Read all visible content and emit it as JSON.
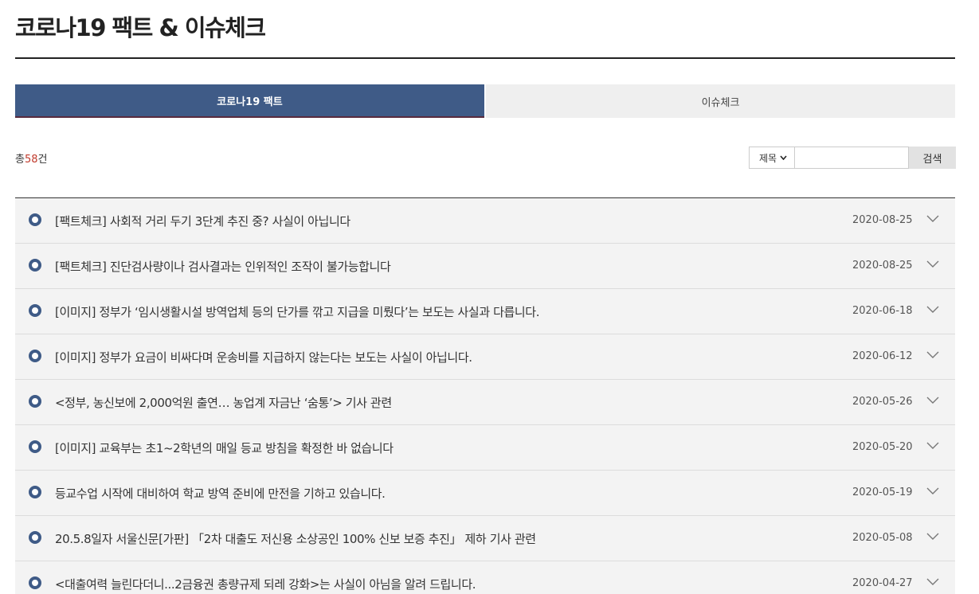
{
  "page": {
    "title": "코로나19 팩트 & 이슈체크"
  },
  "tabs": [
    {
      "label": "코로나19 팩트",
      "active": true
    },
    {
      "label": "이슈체크",
      "active": false
    }
  ],
  "summary": {
    "prefix": "총",
    "count": "58",
    "suffix": "건"
  },
  "search": {
    "select_value": "제목",
    "input_value": "",
    "button_label": "검색"
  },
  "list": [
    {
      "title": "[팩트체크] 사회적 거리 두기 3단계 추진 중? 사실이 아닙니다",
      "date": "2020-08-25"
    },
    {
      "title": "[팩트체크] 진단검사량이나 검사결과는 인위적인 조작이 불가능합니다",
      "date": "2020-08-25"
    },
    {
      "title": "[이미지] 정부가 ‘임시생활시설 방역업체 등의 단가를 깎고 지급을 미뤘다’는 보도는 사실과 다릅니다.",
      "date": "2020-06-18"
    },
    {
      "title": "[이미지] 정부가 요금이 비싸다며 운송비를 지급하지 않는다는 보도는 사실이 아닙니다.",
      "date": "2020-06-12"
    },
    {
      "title": "<정부, 농신보에 2,000억원 출연… 농업계 자금난 ‘숨통’> 기사 관련",
      "date": "2020-05-26"
    },
    {
      "title": "[이미지] 교육부는 초1~2학년의 매일 등교 방침을 확정한 바 없습니다",
      "date": "2020-05-20"
    },
    {
      "title": "등교수업 시작에 대비하여 학교 방역 준비에 만전을 기하고 있습니다.",
      "date": "2020-05-19"
    },
    {
      "title": "20.5.8일자 서울신문[가판] 「2차 대출도 저신용 소상공인 100% 신보 보증 추진」 제하 기사 관련",
      "date": "2020-05-08"
    },
    {
      "title": "<대출여력 늘린다더니...2금융권 총량규제 되레 강화>는 사실이 아님을 알려 드립니다.",
      "date": "2020-04-27"
    }
  ]
}
